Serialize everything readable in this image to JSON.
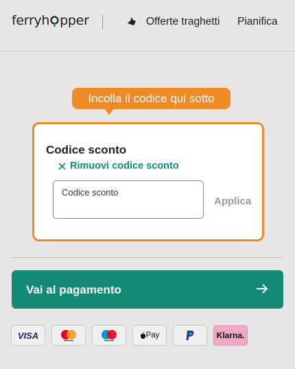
{
  "header": {
    "logo_left": "ferryh",
    "logo_right": "pper",
    "nav_offers": "Offerte traghetti",
    "nav_plan": "Pianifica"
  },
  "tooltip": {
    "text": "Incolla il codice qui sotto"
  },
  "discount": {
    "title": "Codice sconto",
    "remove_label": "Rimuovi codice sconto",
    "input_placeholder": "Codice sconto",
    "apply_label": "Applica"
  },
  "payment": {
    "button_label": "Vai al pagamento"
  },
  "payment_methods": {
    "visa": "VISA",
    "apple_pay": "Pay",
    "klarna": "Klarna."
  },
  "colors": {
    "accent_orange": "#f08a25",
    "brand_green": "#138a74",
    "link_green": "#0f8d77",
    "background": "#e6e6e6"
  },
  "icons": [
    "ferry-icon",
    "close-icon",
    "arrow-right-icon",
    "mastercard-icon",
    "maestro-icon",
    "apple-icon",
    "paypal-icon"
  ]
}
